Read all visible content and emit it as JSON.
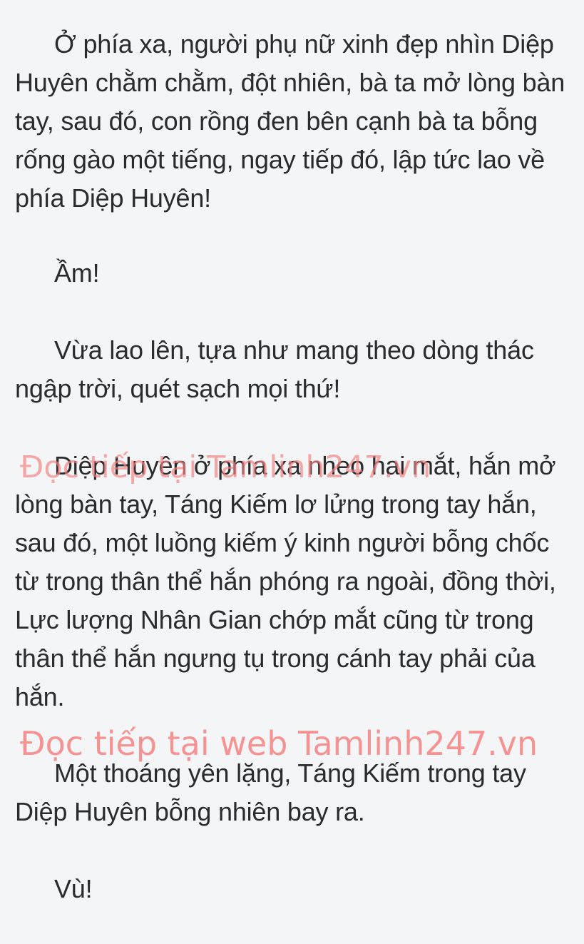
{
  "paragraphs": [
    "Ở phía xa, người phụ nữ xinh đẹp nhìn Diệp Huyên chằm chằm, đột nhiên, bà ta mở lòng bàn tay, sau đó, con rồng đen bên cạnh bà ta bỗng rống gào một tiếng, ngay tiếp đó, lập tức lao về phía Diệp Huyên!",
    "Ầm!",
    "Vừa lao lên, tựa như mang theo dòng thác ngập trời, quét sạch mọi thứ!",
    "Diệp Huyên ở phía xa nheo hai mắt, hắn mở lòng bàn tay, Táng Kiếm lơ lửng trong tay hắn, sau đó, một luồng kiếm ý kinh người bỗng chốc từ trong thân thể hắn phóng ra ngoài, đồng thời, Lực lượng Nhân Gian chớp mắt cũng từ trong thân thể hắn ngưng tụ trong cánh tay phải của hắn.",
    "Một thoáng yên lặng, Táng Kiếm trong tay Diệp Huyên bỗng nhiên bay ra.",
    "Vù!"
  ],
  "watermarks": {
    "overlay": "Đọc tiếp tại Tamlinh247.vn",
    "banner": "Đọc tiếp tại web Tamlinh247.vn"
  }
}
